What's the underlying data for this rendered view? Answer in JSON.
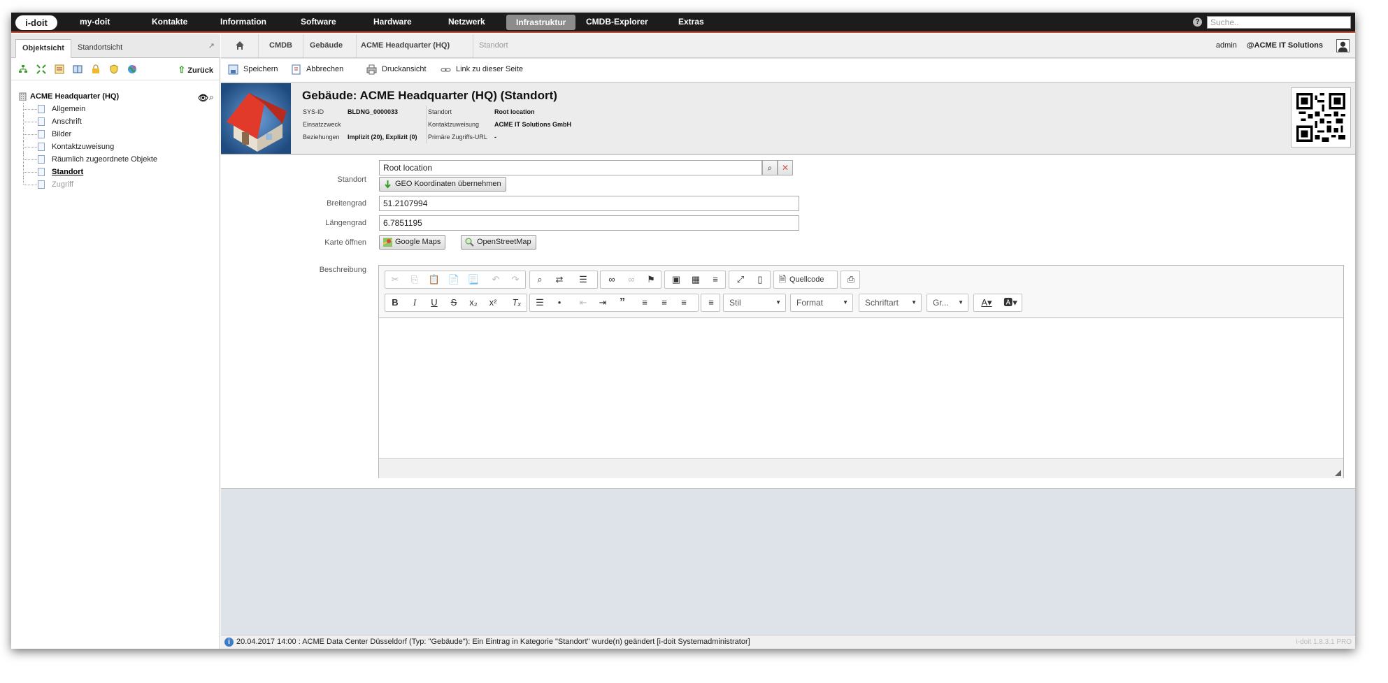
{
  "app": {
    "logo": "i-doit"
  },
  "nav": {
    "items": [
      "my-doit",
      "Kontakte",
      "Information",
      "Software",
      "Hardware",
      "Netzwerk",
      "Infrastruktur",
      "CMDB-Explorer",
      "Extras"
    ],
    "active": "Infrastruktur",
    "search_placeholder": "Suche.."
  },
  "left": {
    "tabs": [
      "Objektsicht",
      "Standortsicht"
    ],
    "active_tab": "Objektsicht",
    "back_label": "Zurück",
    "tree": {
      "root": "ACME Headquarter (HQ)",
      "items": [
        "Allgemein",
        "Anschrift",
        "Bilder",
        "Kontaktzuweisung",
        "Räumlich zugeordnete Objekte",
        "Standort",
        "Zugriff"
      ],
      "selected": "Standort",
      "disabled": "Zugriff"
    }
  },
  "breadcrumb": [
    "CMDB",
    "Gebäude",
    "ACME Headquarter (HQ)",
    "Standort"
  ],
  "user": {
    "name": "admin",
    "tenant": "@ACME IT Solutions"
  },
  "actions": [
    "Speichern",
    "Abbrechen",
    "Druckansicht",
    "Link zu dieser Seite"
  ],
  "header": {
    "title": "Gebäude: ACME Headquarter (HQ) (Standort)",
    "left_meta": [
      {
        "label": "SYS-ID",
        "value": "BLDNG_0000033"
      },
      {
        "label": "Einsatzzweck",
        "value": ""
      },
      {
        "label": "Beziehungen",
        "value": "Implizit (20), Explizit (0)"
      }
    ],
    "right_meta": [
      {
        "label": "Standort",
        "value": "Root location"
      },
      {
        "label": "Kontaktzuweisung",
        "value": "ACME IT Solutions GmbH"
      },
      {
        "label": "Primäre Zugriffs-URL",
        "value": "-"
      }
    ]
  },
  "form": {
    "standort_label": "Standort",
    "standort_value": "Root location",
    "geo_button": "GEO Koordinaten übernehmen",
    "breitengrad_label": "Breitengrad",
    "breitengrad_value": "51.2107994",
    "laengengrad_label": "Längengrad",
    "laengengrad_value": "6.7851195",
    "karte_label": "Karte öffnen",
    "google_maps": "Google Maps",
    "osm": "OpenStreetMap",
    "beschreibung_label": "Beschreibung"
  },
  "editor": {
    "source_label": "Quellcode",
    "combos": [
      "Stil",
      "Format",
      "Schriftart",
      "Gr..."
    ]
  },
  "status": {
    "message": "20.04.2017 14:00 : ACME Data Center Düsseldorf (Typ: \"Gebäude\"): Ein Eintrag in Kategorie \"Standort\" wurde(n) geändert [i-doit Systemadministrator]",
    "version": "i-doit 1.8.3.1 PRO"
  },
  "colors": {
    "nav_bg": "#1c1c1c",
    "accent": "#d8442a",
    "active_nav": "#8c8c8c"
  }
}
